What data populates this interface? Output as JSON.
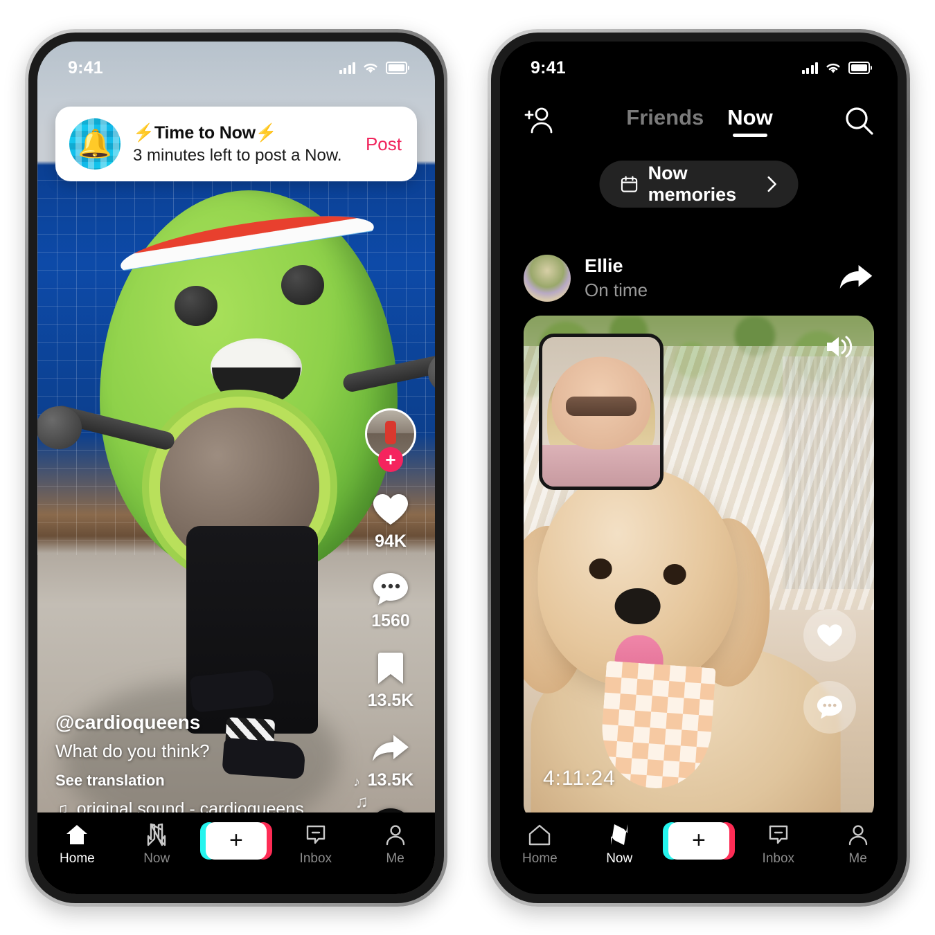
{
  "left_phone": {
    "status_bar": {
      "time": "9:41",
      "signal_icon": "cellular-bars-icon",
      "wifi_icon": "wifi-icon",
      "battery_icon": "battery-icon"
    },
    "notification": {
      "avatar_icon": "bell-icon",
      "title": "⚡Time to Now⚡",
      "subtitle": "3 minutes left to post a Now.",
      "action_label": "Post",
      "action_color": "#f0245c"
    },
    "action_rail": {
      "follow_icon": "plus-icon",
      "items": [
        {
          "icon": "heart-icon",
          "count": "94K"
        },
        {
          "icon": "comment-icon",
          "count": "1560"
        },
        {
          "icon": "bookmark-icon",
          "count": "13.5K"
        },
        {
          "icon": "share-arrow-icon",
          "count": "13.5K"
        }
      ],
      "disc_icon": "music-disc-icon"
    },
    "caption": {
      "username": "@cardioqueens",
      "text": "What do you think?",
      "translate_label": "See translation",
      "sound_icon": "music-note-icon",
      "sound_label": "original sound - cardioqueens"
    },
    "tab_bar": {
      "items": [
        {
          "label": "Home",
          "icon": "home-icon",
          "active": true
        },
        {
          "label": "Now",
          "icon": "now-bolt-icon",
          "active": false
        },
        {
          "label": "",
          "icon": "create-plus-icon",
          "active": false
        },
        {
          "label": "Inbox",
          "icon": "inbox-icon",
          "active": false
        },
        {
          "label": "Me",
          "icon": "person-icon",
          "active": false
        }
      ]
    }
  },
  "right_phone": {
    "status_bar": {
      "time": "9:41",
      "signal_icon": "cellular-bars-icon",
      "wifi_icon": "wifi-icon",
      "battery_icon": "battery-icon"
    },
    "header": {
      "add_friend_icon": "add-person-icon",
      "search_icon": "search-icon",
      "tabs": [
        {
          "label": "Friends",
          "active": false
        },
        {
          "label": "Now",
          "active": true
        }
      ]
    },
    "memories_button": {
      "icon": "calendar-icon",
      "label": "Now memories",
      "chevron_icon": "chevron-right-icon"
    },
    "post": {
      "avatar_icon": "user-avatar",
      "name": "Ellie",
      "status": "On time",
      "share_icon": "share-arrow-icon",
      "speaker_icon": "volume-on-icon",
      "timestamp": "4:11:24",
      "actions": [
        {
          "icon": "heart-icon"
        },
        {
          "icon": "comment-icon"
        }
      ]
    },
    "tab_bar": {
      "items": [
        {
          "label": "Home",
          "icon": "home-icon",
          "active": false
        },
        {
          "label": "Now",
          "icon": "now-bolt-icon",
          "active": true
        },
        {
          "label": "",
          "icon": "create-plus-icon",
          "active": false
        },
        {
          "label": "Inbox",
          "icon": "inbox-icon",
          "active": false
        },
        {
          "label": "Me",
          "icon": "person-icon",
          "active": false
        }
      ]
    }
  },
  "theme": {
    "accent_pink": "#fe2c55",
    "accent_cyan": "#25f4ee",
    "post_red": "#f0245c",
    "dark_bg": "#000000",
    "dim_text": "#8c8c8c"
  }
}
